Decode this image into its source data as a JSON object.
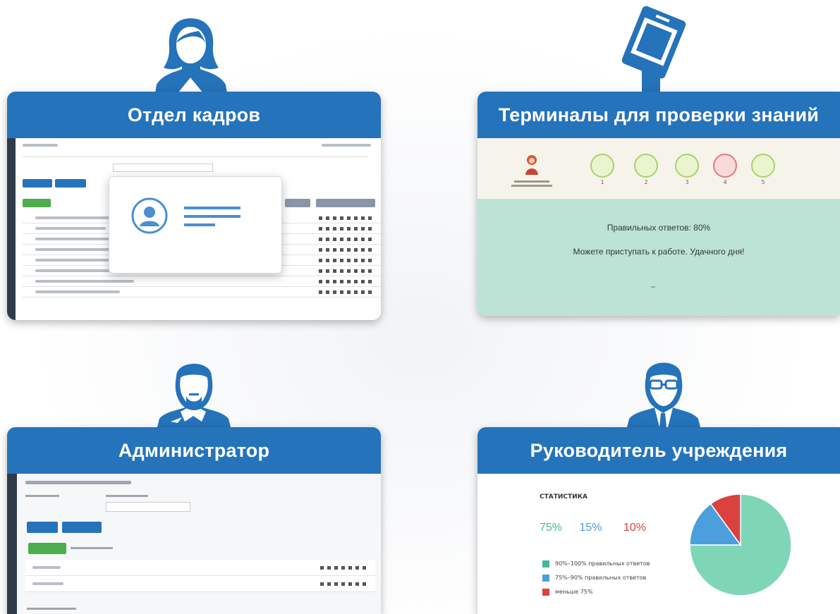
{
  "cards": {
    "hr": {
      "title": "Отдел кадров"
    },
    "terminal": {
      "title": "Терминалы для проверки знаний",
      "result_line": "Правильных ответов: 80%",
      "message": "Можете приступать к работе. Удачного дня!",
      "question_numbers": [
        "1",
        "2",
        "3",
        "4",
        "5"
      ]
    },
    "admin": {
      "title": "Администратор"
    },
    "manager": {
      "title": "Руководитель учреждения",
      "stats_title": "СТАТИСТИКА",
      "percents": [
        {
          "value": "75%",
          "color": "#3fb99b"
        },
        {
          "value": "15%",
          "color": "#4a9fdc"
        },
        {
          "value": "10%",
          "color": "#d9423e"
        }
      ],
      "legend": [
        {
          "label": "90%–100% правильных ответов",
          "color": "#3fb99b"
        },
        {
          "label": "75%–90% правильных ответов",
          "color": "#4a9fdc"
        },
        {
          "label": "меньше 75%",
          "color": "#d9423e"
        }
      ]
    }
  },
  "chart_data": {
    "type": "pie",
    "categories": [
      "90%–100% правильных ответов",
      "75%–90% правильных ответов",
      "меньше 75%"
    ],
    "values": [
      75,
      15,
      10
    ],
    "colors": [
      "#7fd6b6",
      "#4a9fdc",
      "#d9423e"
    ]
  },
  "colors": {
    "brand_blue": "#2573ba",
    "terminal_bg": "#bde3d6"
  }
}
